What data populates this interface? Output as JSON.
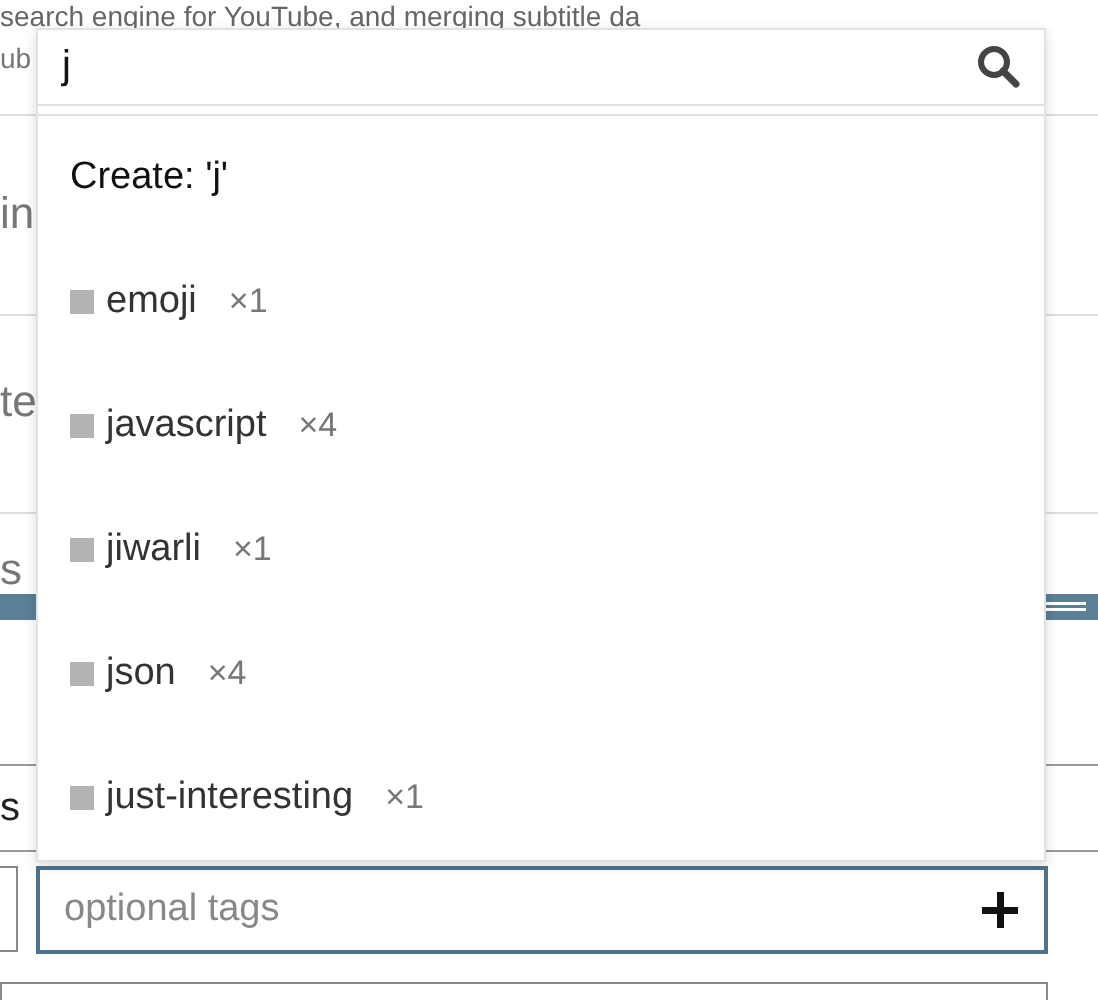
{
  "page": {
    "header_text": "search engine for YouTube, and merging subtitle da",
    "subheader_fragment": "ub",
    "row_fragments": [
      "in",
      "te",
      "s",
      "s"
    ]
  },
  "tag_search": {
    "value": "j"
  },
  "create_option": "Create: 'j'",
  "tags": [
    {
      "name": "emoji",
      "count": "×1"
    },
    {
      "name": "javascript",
      "count": "×4"
    },
    {
      "name": "jiwarli",
      "count": "×1"
    },
    {
      "name": "json",
      "count": "×4"
    },
    {
      "name": "just-interesting",
      "count": "×1"
    }
  ],
  "tag_input": {
    "placeholder": "optional tags"
  }
}
